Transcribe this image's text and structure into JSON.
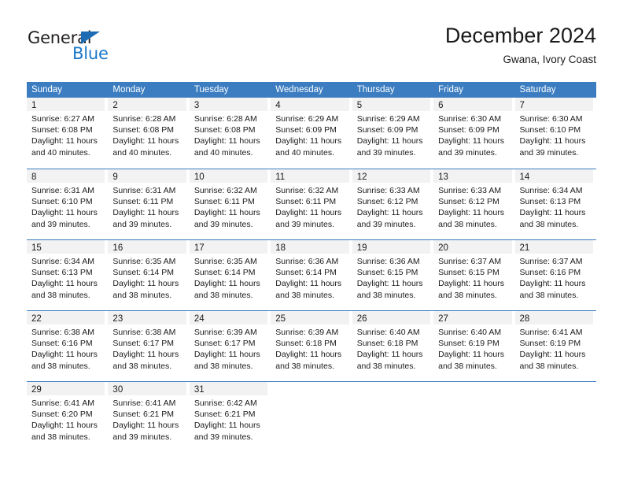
{
  "logo": {
    "line1": "General",
    "line2": "Blue",
    "triangle_icon": "triangle-icon",
    "color_dark": "#231f20",
    "color_blue": "#1b78c9"
  },
  "header": {
    "title": "December 2024",
    "subtitle": "Gwana, Ivory Coast"
  },
  "colors": {
    "header_row_bg": "#3b7dc0",
    "day_band_bg": "#f2f2f2",
    "week_divider": "#3b7dc0",
    "text": "#1a1a1a"
  },
  "weekdays": [
    "Sunday",
    "Monday",
    "Tuesday",
    "Wednesday",
    "Thursday",
    "Friday",
    "Saturday"
  ],
  "weeks": [
    [
      {
        "day": "1",
        "sunrise": "Sunrise: 6:27 AM",
        "sunset": "Sunset: 6:08 PM",
        "daylight1": "Daylight: 11 hours",
        "daylight2": "and 40 minutes."
      },
      {
        "day": "2",
        "sunrise": "Sunrise: 6:28 AM",
        "sunset": "Sunset: 6:08 PM",
        "daylight1": "Daylight: 11 hours",
        "daylight2": "and 40 minutes."
      },
      {
        "day": "3",
        "sunrise": "Sunrise: 6:28 AM",
        "sunset": "Sunset: 6:08 PM",
        "daylight1": "Daylight: 11 hours",
        "daylight2": "and 40 minutes."
      },
      {
        "day": "4",
        "sunrise": "Sunrise: 6:29 AM",
        "sunset": "Sunset: 6:09 PM",
        "daylight1": "Daylight: 11 hours",
        "daylight2": "and 40 minutes."
      },
      {
        "day": "5",
        "sunrise": "Sunrise: 6:29 AM",
        "sunset": "Sunset: 6:09 PM",
        "daylight1": "Daylight: 11 hours",
        "daylight2": "and 39 minutes."
      },
      {
        "day": "6",
        "sunrise": "Sunrise: 6:30 AM",
        "sunset": "Sunset: 6:09 PM",
        "daylight1": "Daylight: 11 hours",
        "daylight2": "and 39 minutes."
      },
      {
        "day": "7",
        "sunrise": "Sunrise: 6:30 AM",
        "sunset": "Sunset: 6:10 PM",
        "daylight1": "Daylight: 11 hours",
        "daylight2": "and 39 minutes."
      }
    ],
    [
      {
        "day": "8",
        "sunrise": "Sunrise: 6:31 AM",
        "sunset": "Sunset: 6:10 PM",
        "daylight1": "Daylight: 11 hours",
        "daylight2": "and 39 minutes."
      },
      {
        "day": "9",
        "sunrise": "Sunrise: 6:31 AM",
        "sunset": "Sunset: 6:11 PM",
        "daylight1": "Daylight: 11 hours",
        "daylight2": "and 39 minutes."
      },
      {
        "day": "10",
        "sunrise": "Sunrise: 6:32 AM",
        "sunset": "Sunset: 6:11 PM",
        "daylight1": "Daylight: 11 hours",
        "daylight2": "and 39 minutes."
      },
      {
        "day": "11",
        "sunrise": "Sunrise: 6:32 AM",
        "sunset": "Sunset: 6:11 PM",
        "daylight1": "Daylight: 11 hours",
        "daylight2": "and 39 minutes."
      },
      {
        "day": "12",
        "sunrise": "Sunrise: 6:33 AM",
        "sunset": "Sunset: 6:12 PM",
        "daylight1": "Daylight: 11 hours",
        "daylight2": "and 39 minutes."
      },
      {
        "day": "13",
        "sunrise": "Sunrise: 6:33 AM",
        "sunset": "Sunset: 6:12 PM",
        "daylight1": "Daylight: 11 hours",
        "daylight2": "and 38 minutes."
      },
      {
        "day": "14",
        "sunrise": "Sunrise: 6:34 AM",
        "sunset": "Sunset: 6:13 PM",
        "daylight1": "Daylight: 11 hours",
        "daylight2": "and 38 minutes."
      }
    ],
    [
      {
        "day": "15",
        "sunrise": "Sunrise: 6:34 AM",
        "sunset": "Sunset: 6:13 PM",
        "daylight1": "Daylight: 11 hours",
        "daylight2": "and 38 minutes."
      },
      {
        "day": "16",
        "sunrise": "Sunrise: 6:35 AM",
        "sunset": "Sunset: 6:14 PM",
        "daylight1": "Daylight: 11 hours",
        "daylight2": "and 38 minutes."
      },
      {
        "day": "17",
        "sunrise": "Sunrise: 6:35 AM",
        "sunset": "Sunset: 6:14 PM",
        "daylight1": "Daylight: 11 hours",
        "daylight2": "and 38 minutes."
      },
      {
        "day": "18",
        "sunrise": "Sunrise: 6:36 AM",
        "sunset": "Sunset: 6:14 PM",
        "daylight1": "Daylight: 11 hours",
        "daylight2": "and 38 minutes."
      },
      {
        "day": "19",
        "sunrise": "Sunrise: 6:36 AM",
        "sunset": "Sunset: 6:15 PM",
        "daylight1": "Daylight: 11 hours",
        "daylight2": "and 38 minutes."
      },
      {
        "day": "20",
        "sunrise": "Sunrise: 6:37 AM",
        "sunset": "Sunset: 6:15 PM",
        "daylight1": "Daylight: 11 hours",
        "daylight2": "and 38 minutes."
      },
      {
        "day": "21",
        "sunrise": "Sunrise: 6:37 AM",
        "sunset": "Sunset: 6:16 PM",
        "daylight1": "Daylight: 11 hours",
        "daylight2": "and 38 minutes."
      }
    ],
    [
      {
        "day": "22",
        "sunrise": "Sunrise: 6:38 AM",
        "sunset": "Sunset: 6:16 PM",
        "daylight1": "Daylight: 11 hours",
        "daylight2": "and 38 minutes."
      },
      {
        "day": "23",
        "sunrise": "Sunrise: 6:38 AM",
        "sunset": "Sunset: 6:17 PM",
        "daylight1": "Daylight: 11 hours",
        "daylight2": "and 38 minutes."
      },
      {
        "day": "24",
        "sunrise": "Sunrise: 6:39 AM",
        "sunset": "Sunset: 6:17 PM",
        "daylight1": "Daylight: 11 hours",
        "daylight2": "and 38 minutes."
      },
      {
        "day": "25",
        "sunrise": "Sunrise: 6:39 AM",
        "sunset": "Sunset: 6:18 PM",
        "daylight1": "Daylight: 11 hours",
        "daylight2": "and 38 minutes."
      },
      {
        "day": "26",
        "sunrise": "Sunrise: 6:40 AM",
        "sunset": "Sunset: 6:18 PM",
        "daylight1": "Daylight: 11 hours",
        "daylight2": "and 38 minutes."
      },
      {
        "day": "27",
        "sunrise": "Sunrise: 6:40 AM",
        "sunset": "Sunset: 6:19 PM",
        "daylight1": "Daylight: 11 hours",
        "daylight2": "and 38 minutes."
      },
      {
        "day": "28",
        "sunrise": "Sunrise: 6:41 AM",
        "sunset": "Sunset: 6:19 PM",
        "daylight1": "Daylight: 11 hours",
        "daylight2": "and 38 minutes."
      }
    ],
    [
      {
        "day": "29",
        "sunrise": "Sunrise: 6:41 AM",
        "sunset": "Sunset: 6:20 PM",
        "daylight1": "Daylight: 11 hours",
        "daylight2": "and 38 minutes."
      },
      {
        "day": "30",
        "sunrise": "Sunrise: 6:41 AM",
        "sunset": "Sunset: 6:21 PM",
        "daylight1": "Daylight: 11 hours",
        "daylight2": "and 39 minutes."
      },
      {
        "day": "31",
        "sunrise": "Sunrise: 6:42 AM",
        "sunset": "Sunset: 6:21 PM",
        "daylight1": "Daylight: 11 hours",
        "daylight2": "and 39 minutes."
      },
      {
        "day": "",
        "sunrise": "",
        "sunset": "",
        "daylight1": "",
        "daylight2": ""
      },
      {
        "day": "",
        "sunrise": "",
        "sunset": "",
        "daylight1": "",
        "daylight2": ""
      },
      {
        "day": "",
        "sunrise": "",
        "sunset": "",
        "daylight1": "",
        "daylight2": ""
      },
      {
        "day": "",
        "sunrise": "",
        "sunset": "",
        "daylight1": "",
        "daylight2": ""
      }
    ]
  ]
}
